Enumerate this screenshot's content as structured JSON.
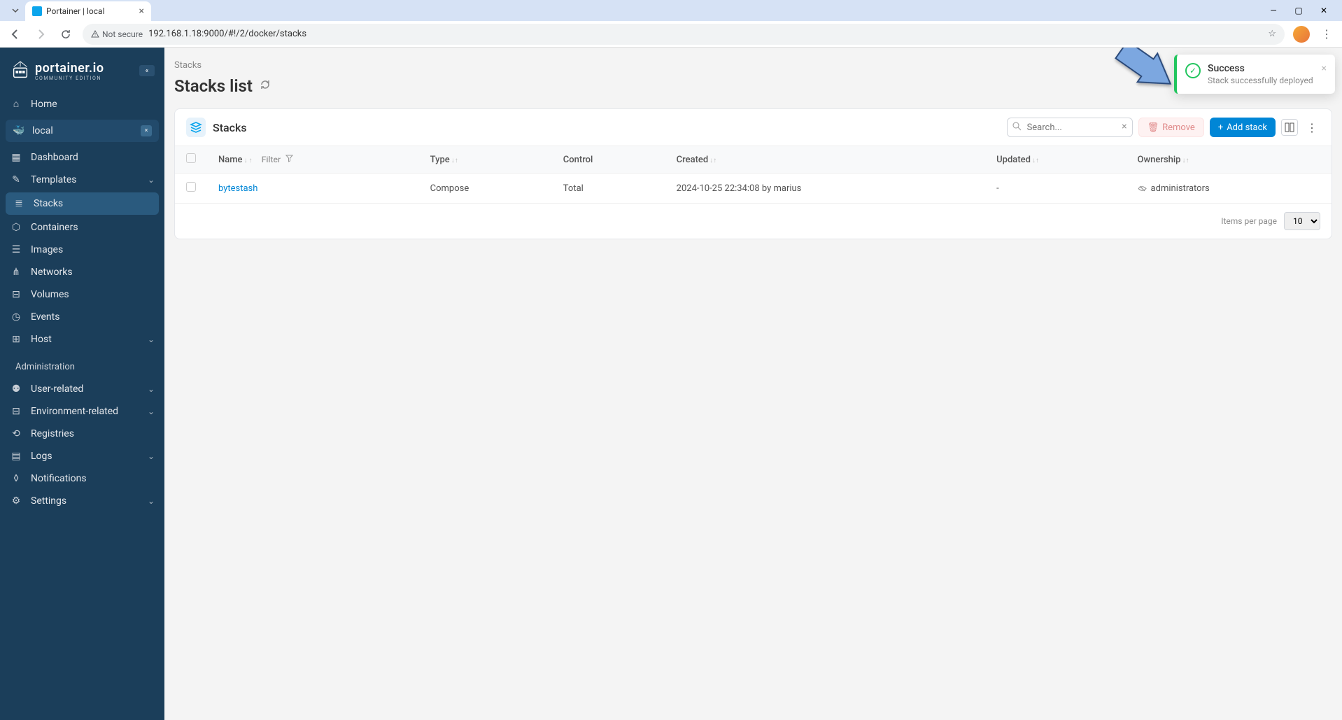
{
  "browser": {
    "tab_title": "Portainer | local",
    "not_secure_label": "Not secure",
    "url": "192.168.1.18:9000/#!/2/docker/stacks"
  },
  "logo": {
    "name": "portainer.io",
    "subtitle": "COMMUNITY EDITION"
  },
  "nav": {
    "home": "Home",
    "env_name": "local",
    "items": [
      {
        "label": "Dashboard",
        "icon": "▦"
      },
      {
        "label": "Templates",
        "icon": "✎",
        "chevron": true
      },
      {
        "label": "Stacks",
        "icon": "≣",
        "active": true
      },
      {
        "label": "Containers",
        "icon": "⬡"
      },
      {
        "label": "Images",
        "icon": "☰"
      },
      {
        "label": "Networks",
        "icon": "⋔"
      },
      {
        "label": "Volumes",
        "icon": "⊟"
      },
      {
        "label": "Events",
        "icon": "◷"
      },
      {
        "label": "Host",
        "icon": "⊞",
        "chevron": true
      }
    ],
    "admin_title": "Administration",
    "admin_items": [
      {
        "label": "User-related",
        "icon": "⚉",
        "chevron": true
      },
      {
        "label": "Environment-related",
        "icon": "⊟",
        "chevron": true
      },
      {
        "label": "Registries",
        "icon": "⟲"
      },
      {
        "label": "Logs",
        "icon": "▤",
        "chevron": true
      },
      {
        "label": "Notifications",
        "icon": "◊"
      },
      {
        "label": "Settings",
        "icon": "⚙",
        "chevron": true
      }
    ]
  },
  "page": {
    "breadcrumb": "Stacks",
    "title": "Stacks list",
    "card_title": "Stacks",
    "search_placeholder": "Search...",
    "remove_label": "Remove",
    "add_label": "Add stack",
    "columns": {
      "name": "Name",
      "filter": "Filter",
      "type": "Type",
      "control": "Control",
      "created": "Created",
      "updated": "Updated",
      "ownership": "Ownership"
    },
    "rows": [
      {
        "name": "bytestash",
        "type": "Compose",
        "control": "Total",
        "created": "2024-10-25 22:34:08 by marius",
        "updated": "-",
        "ownership": "administrators"
      }
    ],
    "items_per_page_label": "Items per page",
    "items_per_page_value": "10"
  },
  "toast": {
    "title": "Success",
    "message": "Stack successfully deployed"
  }
}
